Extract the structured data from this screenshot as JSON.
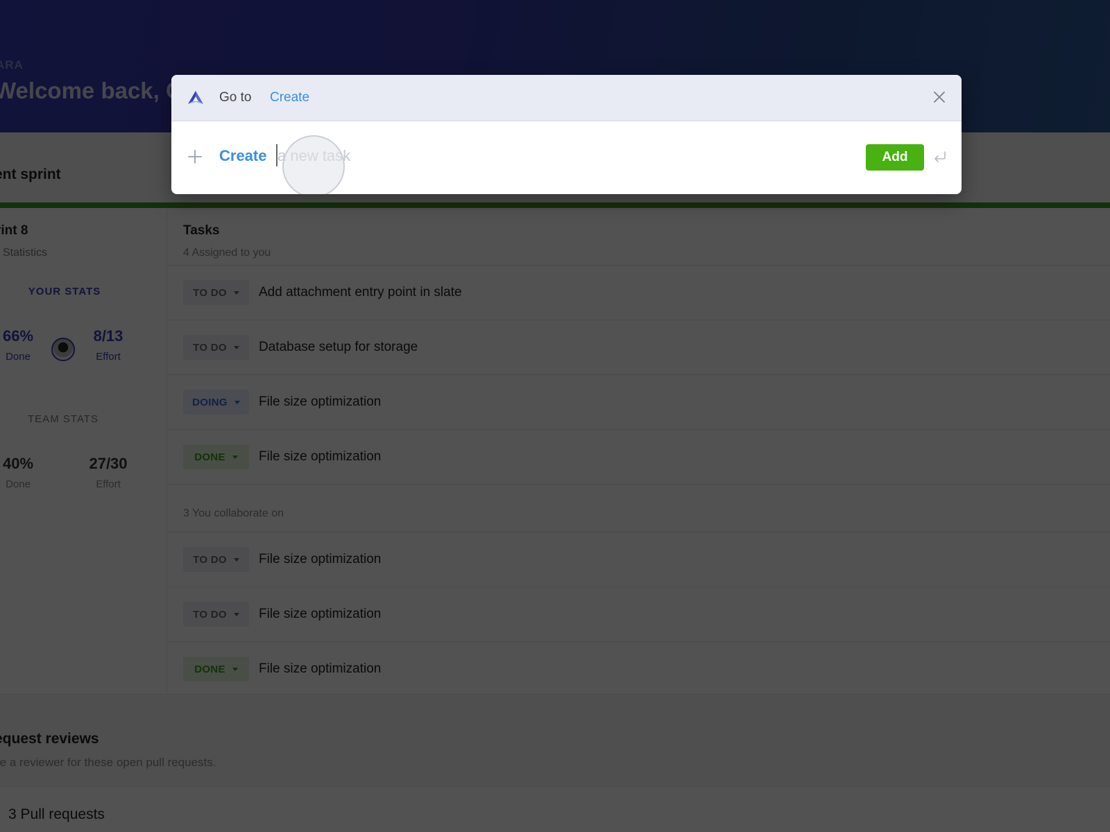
{
  "page": {
    "workspace_label": "ARA",
    "welcome": "Welcome back, C",
    "section_title": "ent sprint",
    "sprint": {
      "title": "rint 8",
      "subtitle": "Statistics",
      "your_stats_label": "YOUR STATS",
      "your_done_value": "66%",
      "your_done_label": "Done",
      "your_effort_value": "8/13",
      "your_effort_label": "Effort",
      "team_stats_label": "TEAM STATS",
      "team_done_value": "40%",
      "team_done_label": "Done",
      "team_effort_value": "27/30",
      "team_effort_label": "Effort"
    },
    "tasks": {
      "title": "Tasks",
      "assigned_label": "4 Assigned to you",
      "assigned": [
        {
          "status": "TO DO",
          "kind": "todo",
          "title": "Add attachment entry point in slate"
        },
        {
          "status": "TO DO",
          "kind": "todo",
          "title": "Database setup for storage"
        },
        {
          "status": "DOING",
          "kind": "doing",
          "title": "File size optimization"
        },
        {
          "status": "DONE",
          "kind": "done",
          "title": "File size optimization"
        }
      ],
      "collab_label": "3 You collaborate on",
      "collab": [
        {
          "status": "TO DO",
          "kind": "todo",
          "title": "File size optimization"
        },
        {
          "status": "TO DO",
          "kind": "todo",
          "title": "File size optimization"
        },
        {
          "status": "DONE",
          "kind": "done",
          "title": "File size optimization"
        }
      ]
    },
    "reviews": {
      "title": "equest reviews",
      "subtitle": "re a reviewer for these open pull requests.",
      "count_label": "3 Pull requests"
    }
  },
  "modal": {
    "goto_label": "Go to",
    "breadcrumb": "Create",
    "command": "Create",
    "input_value": "",
    "input_placeholder": "a new task",
    "add_label": "Add",
    "icons": {
      "logo": "app-logo-icon",
      "close": "close-icon",
      "plus": "plus-icon",
      "enter": "enter-key-icon"
    }
  },
  "colors": {
    "accent_blue": "#3a8fe0",
    "brand_indigo": "#3a3fb5",
    "add_green": "#47b211",
    "sprint_bar_green": "#3c9a1e"
  }
}
